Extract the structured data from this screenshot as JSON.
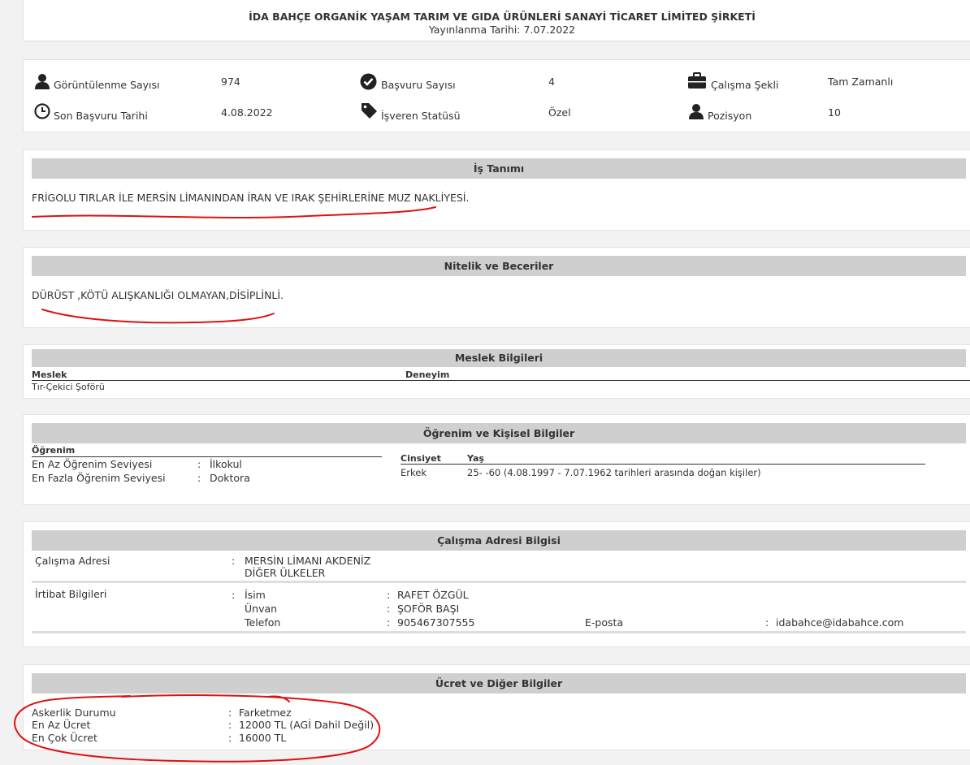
{
  "header": {
    "company": "İDA BAHÇE ORGANİK YAŞAM TARIM VE GIDA ÜRÜNLERİ SANAYİ TİCARET LİMİTED ŞİRKETİ",
    "published_label": "Yayınlanma Tarihi:",
    "published_date": "7.07.2022"
  },
  "stats": {
    "views_label": "Görüntülenme Sayısı",
    "views_value": "974",
    "applications_label": "Başvuru Sayısı",
    "applications_value": "4",
    "work_type_label": "Çalışma Şekli",
    "work_type_value": "Tam Zamanlı",
    "deadline_label": "Son Başvuru Tarihi",
    "deadline_value": "4.08.2022",
    "employer_status_label": "İşveren Statüsü",
    "employer_status_value": "Özel",
    "position_label": "Pozisyon",
    "position_value": "10",
    "icons": [
      "user-icon",
      "check-circle-icon",
      "briefcase-icon",
      "clock-icon",
      "tag-icon",
      "user-icon"
    ]
  },
  "job_description": {
    "title": "İş Tanımı",
    "text": "FRİGOLU TIRLAR İLE MERSİN LİMANINDAN İRAN VE IRAK ŞEHİRLERİNE MUZ NAKLİYESİ."
  },
  "skills": {
    "title": "Nitelik ve Beceriler",
    "text": "DÜRÜST ,KÖTÜ ALIŞKANLIĞI OLMAYAN,DİSİPLİNLİ."
  },
  "profession": {
    "title": "Meslek Bilgileri",
    "col_profession": "Meslek",
    "col_experience": "Deneyim",
    "rows": [
      {
        "profession": "Tır-Çekici Şoförü",
        "experience": ""
      }
    ]
  },
  "education": {
    "title": "Öğrenim ve Kişisel Bilgiler",
    "heading": "Öğrenim",
    "min_label": "En Az Öğrenim Seviyesi",
    "min_value": "İlkokul",
    "max_label": "En Fazla Öğrenim Seviyesi",
    "max_value": "Doktora",
    "gender_label": "Cinsiyet",
    "age_label": "Yaş",
    "gender_value": "Erkek",
    "age_value": "25- -60 (4.08.1997 - 7.07.1962 tarihleri arasında doğan kişiler)"
  },
  "address": {
    "title": "Çalışma Adresi Bilgisi",
    "address_label": "Çalışma Adresi",
    "address_line1": "MERSİN LİMANI AKDENİZ",
    "address_line2": "DİĞER ÜLKELER",
    "contact_label": "İrtibat Bilgileri",
    "name_label": "İsim",
    "name_value": "RAFET ÖZGÜL",
    "title_label": "Ünvan",
    "title_value": "ŞOFÖR BAŞI",
    "phone_label": "Telefon",
    "phone_value": "905467307555",
    "email_label": "E-posta",
    "email_value": "idabahce@idabahce.com"
  },
  "salary": {
    "title": "Ücret ve Diğer Bilgiler",
    "military_label": "Askerlik Durumu",
    "military_value": "Farketmez",
    "min_label": "En Az Ücret",
    "min_value": "12000 TL (AGİ Dahil Değil)",
    "max_label": "En Çok Ücret",
    "max_value": "16000 TL"
  },
  "separator": ":",
  "colors": {
    "annotation": "#e01010",
    "section_bg": "#cfcfcf",
    "page_bg": "#f2f2f2"
  }
}
